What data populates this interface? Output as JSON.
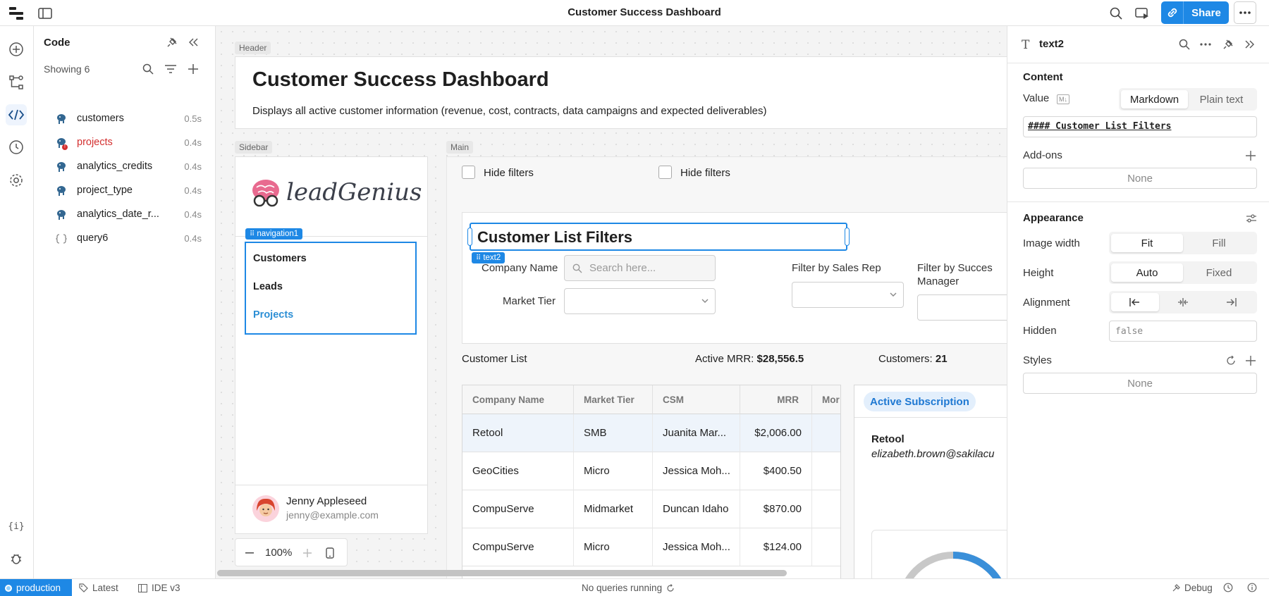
{
  "app": {
    "title": "Customer Success Dashboard",
    "share_label": "Share"
  },
  "code_panel": {
    "title": "Code",
    "showing": "Showing 6",
    "queries": [
      {
        "name": "customers",
        "time": "0.5s",
        "icon": "database-icon",
        "error": false
      },
      {
        "name": "projects",
        "time": "0.4s",
        "icon": "database-icon",
        "error": true
      },
      {
        "name": "analytics_credits",
        "time": "0.4s",
        "icon": "database-icon",
        "error": false
      },
      {
        "name": "project_type",
        "time": "0.4s",
        "icon": "database-icon",
        "error": false
      },
      {
        "name": "analytics_date_r...",
        "time": "0.4s",
        "icon": "database-icon",
        "error": false
      },
      {
        "name": "query6",
        "time": "0.4s",
        "icon": "code-braces-icon",
        "error": false
      }
    ]
  },
  "canvas": {
    "frames": {
      "header": "Header",
      "sidebar": "Sidebar",
      "main": "Main"
    },
    "header": {
      "title": "Customer Success Dashboard",
      "description": "Displays all active customer information (revenue, cost, contracts, data campaigns and expected deliverables)"
    },
    "sidebar": {
      "logo_text": "leadGenius",
      "nav_tag": "navigation1",
      "nav_items": [
        "Customers",
        "Leads",
        "Projects"
      ],
      "user": {
        "name": "Jenny Appleseed",
        "email": "jenny@example.com"
      }
    },
    "main": {
      "hide_filters_1": "Hide filters",
      "hide_filters_2": "Hide filters",
      "filters_title": "Customer List Filters",
      "text_tag": "text2",
      "company_name_label": "Company Name",
      "search_placeholder": "Search here...",
      "market_tier_label": "Market Tier",
      "sales_rep_label": "Filter by Sales Rep",
      "success_manager_label_1": "Filter by Succes",
      "success_manager_label_2": "Manager",
      "customer_list_label": "Customer List",
      "active_mrr_label": "Active MRR:",
      "active_mrr_value": "$28,556.5",
      "customers_label": "Customers:",
      "customers_value": "21",
      "table": {
        "columns": [
          "Company Name",
          "Market Tier",
          "CSM",
          "MRR",
          "Mor"
        ],
        "rows": [
          [
            "Retool",
            "SMB",
            "Juanita Mar...",
            "$2,006.00",
            ""
          ],
          [
            "GeoCities",
            "Micro",
            "Jessica Moh...",
            "$400.50",
            ""
          ],
          [
            "CompuServe",
            "Midmarket",
            "Duncan Idaho",
            "$870.00",
            ""
          ],
          [
            "CompuServe",
            "Micro",
            "Jessica Moh...",
            "$124.00",
            ""
          ]
        ]
      },
      "detail": {
        "tab": "Active Subscription",
        "company": "Retool",
        "email": "elizabeth.brown@sakilacu"
      }
    },
    "zoom": "100%"
  },
  "inspector": {
    "title": "text2",
    "content_title": "Content",
    "value_label": "Value",
    "value_mode_options": [
      "Markdown",
      "Plain text"
    ],
    "value": "#### Customer List Filters",
    "addons_label": "Add-ons",
    "addons_value": "None",
    "appearance_title": "Appearance",
    "image_width_label": "Image width",
    "image_width_options": [
      "Fit",
      "Fill"
    ],
    "height_label": "Height",
    "height_options": [
      "Auto",
      "Fixed"
    ],
    "alignment_label": "Alignment",
    "hidden_label": "Hidden",
    "hidden_value": "false",
    "styles_label": "Styles",
    "styles_value": "None"
  },
  "statusbar": {
    "environment": "production",
    "version": "Latest",
    "ide": "IDE v3",
    "queries_status": "No queries running",
    "debug": "Debug"
  },
  "colors": {
    "accent": "#1e88e5",
    "error": "#d32f2f",
    "link": "#2d8fd5"
  }
}
